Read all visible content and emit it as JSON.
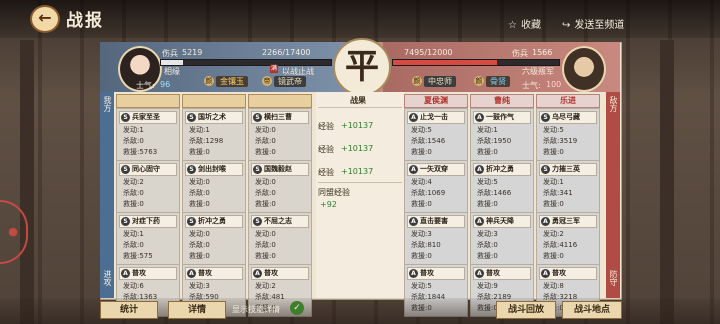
{
  "header": {
    "title": "战报",
    "back_icon": "back-arrow-icon",
    "favorite_label": "收藏",
    "send_label": "发送至频道"
  },
  "result": {
    "label": "平"
  },
  "left_army": {
    "casualties_label": "伤兵",
    "casualties": "5219",
    "troops": "2266/17400",
    "troops_current": 2266,
    "troops_max": 17400,
    "name": "相缘",
    "morale_label": "士气:",
    "morale": "96",
    "status_mark": "满",
    "status_text": "以战止战",
    "title_mark": "颜",
    "title_tag": "金镶玉",
    "rank_mark": "帝",
    "rank_tag": "镜武帝"
  },
  "right_army": {
    "casualties_label": "伤兵",
    "casualties": "1566",
    "troops": "7495/12000",
    "troops_current": 7495,
    "troops_max": 12000,
    "name": "六级叛军",
    "morale_label": "士气:",
    "morale": "100",
    "title_mark": "颜",
    "title_tag": "中忠师",
    "rank_mark": "颜",
    "rank_tag": "骨贤"
  },
  "side_labels": {
    "left_top": "我方",
    "left_bottom": "进攻",
    "right_top": "敌方",
    "right_bottom": "防守"
  },
  "left_generals": [
    {
      "name": "",
      "skills": [
        {
          "icon": "S",
          "name": "兵家至圣",
          "stats": [
            "发动:1",
            "杀敌:0",
            "救援:5763"
          ]
        },
        {
          "icon": "S",
          "name": "同心固守",
          "stats": [
            "发动:2",
            "杀敌:0",
            "救援:0"
          ]
        },
        {
          "icon": "S",
          "name": "对症下药",
          "stats": [
            "发动:1",
            "杀敌:0",
            "救援:575"
          ]
        },
        {
          "icon": "A",
          "name": "普攻",
          "stats": [
            "发动:6",
            "杀敌:1363",
            "救援:0"
          ]
        }
      ]
    },
    {
      "name": "",
      "skills": [
        {
          "icon": "S",
          "name": "国圻之术",
          "stats": [
            "发动:1",
            "杀敌:1298",
            "救援:0"
          ]
        },
        {
          "icon": "S",
          "name": "剑出封喉",
          "stats": [
            "发动:0",
            "杀敌:0",
            "救援:0"
          ]
        },
        {
          "icon": "S",
          "name": "折冲之勇",
          "stats": [
            "发动:0",
            "杀敌:0",
            "救援:0"
          ]
        },
        {
          "icon": "A",
          "name": "普攻",
          "stats": [
            "发动:3",
            "杀敌:590",
            "救援:0"
          ]
        }
      ]
    },
    {
      "name": "",
      "skills": [
        {
          "icon": "S",
          "name": "横扫三曹",
          "stats": [
            "发动:0",
            "杀敌:0",
            "救援:0"
          ]
        },
        {
          "icon": "S",
          "name": "国魏毅赵",
          "stats": [
            "发动:0",
            "杀敌:0",
            "救援:0"
          ]
        },
        {
          "icon": "S",
          "name": "不屈之志",
          "stats": [
            "发动:0",
            "杀敌:0",
            "救援:0"
          ]
        },
        {
          "icon": "A",
          "name": "普攻",
          "stats": [
            "发动:2",
            "杀敌:481",
            "救援:0"
          ]
        }
      ]
    }
  ],
  "battle_results": {
    "title": "战果",
    "rows": [
      {
        "name": "",
        "label": "经验",
        "value": "+10137"
      },
      {
        "name": "",
        "label": "经验",
        "value": "+10137"
      },
      {
        "name": "",
        "label": "经验",
        "value": "+10137"
      }
    ],
    "alliance_label": "同盟经验",
    "alliance_value": "+92"
  },
  "right_generals": [
    {
      "name": "夏侯渊",
      "skills": [
        {
          "icon": "A",
          "name": "止戈一击",
          "stats": [
            "发动:5",
            "杀敌:1546",
            "救援:0"
          ]
        },
        {
          "icon": "A",
          "name": "一矢双穿",
          "stats": [
            "发动:4",
            "杀敌:1069",
            "救援:0"
          ]
        },
        {
          "icon": "A",
          "name": "直击要害",
          "stats": [
            "发动:3",
            "杀敌:810",
            "救援:0"
          ]
        },
        {
          "icon": "A",
          "name": "普攻",
          "stats": [
            "发动:5",
            "杀敌:1844",
            "救援:0"
          ]
        }
      ]
    },
    {
      "name": "曹纯",
      "skills": [
        {
          "icon": "A",
          "name": "一鼓作气",
          "stats": [
            "发动:1",
            "杀敌:1950",
            "救援:0"
          ]
        },
        {
          "icon": "A",
          "name": "折冲之勇",
          "stats": [
            "发动:5",
            "杀敌:1466",
            "救援:0"
          ]
        },
        {
          "icon": "A",
          "name": "神兵天降",
          "stats": [
            "发动:3",
            "杀敌:0",
            "救援:0"
          ]
        },
        {
          "icon": "A",
          "name": "普攻",
          "stats": [
            "发动:9",
            "杀敌:2189",
            "救援:0"
          ]
        }
      ]
    },
    {
      "name": "乐进",
      "skills": [
        {
          "icon": "S",
          "name": "乌尽弓藏",
          "stats": [
            "发动:5",
            "杀敌:3519",
            "救援:0"
          ]
        },
        {
          "icon": "S",
          "name": "力摧三英",
          "stats": [
            "发动:1",
            "杀敌:341",
            "救援:0"
          ]
        },
        {
          "icon": "A",
          "name": "勇冠三军",
          "stats": [
            "发动:2",
            "杀敌:4116",
            "救援:0"
          ]
        },
        {
          "icon": "A",
          "name": "普攻",
          "stats": [
            "发动:8",
            "杀敌:3218",
            "救援:0"
          ]
        }
      ]
    }
  ],
  "footer": {
    "stats_label": "统计",
    "details_label": "详情",
    "skill_toggle_label": "显示技能详情",
    "replay_label": "战斗回放",
    "location_label": "战斗地点"
  },
  "colors": {
    "left_bar": "#e6e6e6",
    "right_bar": "#d64a42",
    "accent_green": "#2f7d2a"
  }
}
